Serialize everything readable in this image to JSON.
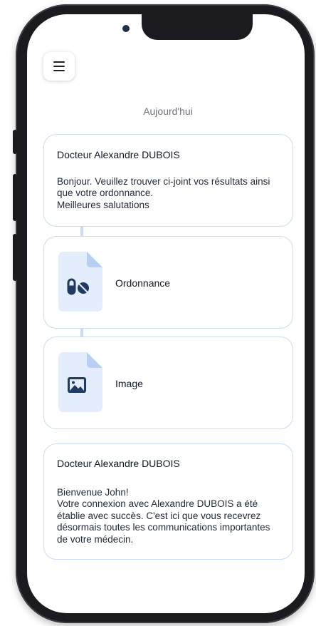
{
  "header": {
    "menu_icon": "hamburger-menu-icon"
  },
  "timeline": {
    "date_label": "Aujourd'hui"
  },
  "messages": [
    {
      "sender": "Docteur  Alexandre DUBOIS",
      "body": "Bonjour. Veuillez trouver ci-joint vos résultats ainsi que votre ordonnance.\nMeilleures salutations"
    },
    {
      "sender": "Docteur  Alexandre DUBOIS",
      "body": "Bienvenue John!\nVotre connexion avec  Alexandre DUBOIS a été établie avec succès. C'est ici que vous recevrez désormais toutes les communications importantes de votre médecin."
    }
  ],
  "attachments": [
    {
      "label": "Ordonnance",
      "icon": "pills-icon"
    },
    {
      "label": "Image",
      "icon": "image-icon"
    }
  ],
  "colors": {
    "card_border": "#c9dcf6",
    "file_icon_bg": "#e3edfb",
    "file_icon_fold": "#b7cff0",
    "icon_glyph": "#1f3b63"
  }
}
